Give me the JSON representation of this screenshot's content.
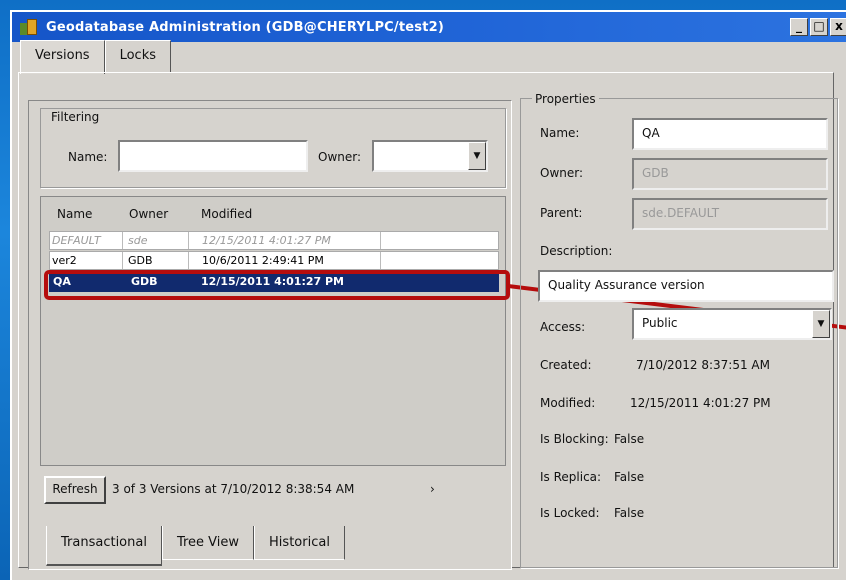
{
  "window": {
    "title": "Geodatabase Administration (GDB@CHERYLPC/test2)",
    "minimize": "_",
    "maximize": "□",
    "close": "x"
  },
  "top_tabs": [
    {
      "label": "Versions",
      "active": true
    },
    {
      "label": "Locks",
      "active": false
    }
  ],
  "filtering": {
    "legend": "Filtering",
    "name_label": "Name:",
    "name_value": "",
    "owner_label": "Owner:",
    "owner_value": ""
  },
  "versions_list": {
    "columns": [
      "Name",
      "Owner",
      "Modified"
    ],
    "rows": [
      {
        "name": "DEFAULT",
        "owner": "sde",
        "modified": "12/15/2011 4:01:27 PM",
        "state": "default"
      },
      {
        "name": "ver2",
        "owner": "GDB",
        "modified": "10/6/2011 2:49:41 PM",
        "state": "normal"
      },
      {
        "name": "QA",
        "owner": "GDB",
        "modified": "12/15/2011 4:01:27 PM",
        "state": "selected"
      }
    ]
  },
  "footer": {
    "refresh_label": "Refresh",
    "status_text": "3 of 3 Versions at 7/10/2012 8:38:54 AM",
    "more": "›"
  },
  "bottom_tabs": [
    {
      "label": "Transactional",
      "active": true
    },
    {
      "label": "Tree View",
      "active": false
    },
    {
      "label": "Historical",
      "active": false
    }
  ],
  "properties": {
    "legend": "Properties",
    "name_label": "Name:",
    "name_value": "QA",
    "owner_label": "Owner:",
    "owner_value": "GDB",
    "parent_label": "Parent:",
    "parent_value": "sde.DEFAULT",
    "description_label": "Description:",
    "description_value": "Quality Assurance version",
    "access_label": "Access:",
    "access_value": "Public",
    "created_label": "Created:",
    "created_value": "7/10/2012 8:37:51 AM",
    "modified_label": "Modified:",
    "modified_value": "12/15/2011 4:01:27 PM",
    "blocking_label": "Is Blocking:",
    "blocking_value": "False",
    "replica_label": "Is Replica:",
    "replica_value": "False",
    "locked_label": "Is Locked:",
    "locked_value": "False"
  },
  "colors": {
    "background": "#1077cc",
    "titlebar": "#1f63d6",
    "selection": "#112a6e",
    "callout": "#b50d0d"
  }
}
